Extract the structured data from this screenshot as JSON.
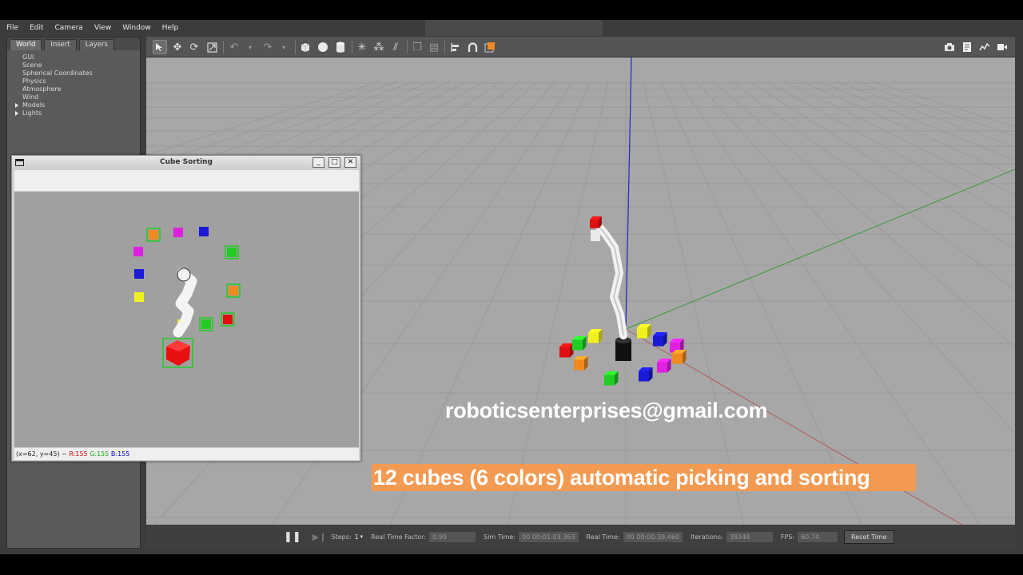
{
  "menubar": {
    "items": [
      "File",
      "Edit",
      "Camera",
      "View",
      "Window",
      "Help"
    ]
  },
  "leftpanel": {
    "tabs": [
      "World",
      "Insert",
      "Layers"
    ],
    "tree": [
      {
        "label": "GUI",
        "expandable": false
      },
      {
        "label": "Scene",
        "expandable": false
      },
      {
        "label": "Spherical Coordinates",
        "expandable": false
      },
      {
        "label": "Physics",
        "expandable": false
      },
      {
        "label": "Atmosphere",
        "expandable": false
      },
      {
        "label": "Wind",
        "expandable": false
      },
      {
        "label": "Models",
        "expandable": true
      },
      {
        "label": "Lights",
        "expandable": true
      }
    ]
  },
  "toolbar": {
    "icons": [
      "select-arrow-icon",
      "translate-icon",
      "rotate-icon",
      "scale-icon",
      "undo-icon",
      "redo-icon",
      "box-shape-icon",
      "sphere-shape-icon",
      "cylinder-shape-icon",
      "point-light-icon",
      "spot-light-icon",
      "directional-light-icon",
      "copy-icon",
      "paste-icon",
      "align-icon",
      "snap-icon",
      "view-angle-icon",
      "screenshot-icon",
      "log-icon",
      "plot-icon",
      "record-icon"
    ]
  },
  "cv_window": {
    "title": "Cube Sorting",
    "status": {
      "coords": "(x=62, y=45) ~",
      "r": "R:155",
      "g": "G:155",
      "b": "B:155"
    }
  },
  "bottombar": {
    "steps_label": "Steps:",
    "steps_value": "1",
    "rtf_label": "Real Time Factor:",
    "rtf_value": "0.99",
    "sim_label": "Sim Time:",
    "sim_value": "00 00:01:03.363",
    "real_label": "Real Time:",
    "real_value": "00 00:00:39.460",
    "iter_label": "Iterations:",
    "iter_value": "38348",
    "fps_label": "FPS:",
    "fps_value": "60.74",
    "reset_label": "Reset Time"
  },
  "overlay": {
    "email": "roboticsenterprises@gmail.com",
    "caption": "12 cubes (6 colors) automatic picking and sorting"
  },
  "colors": {
    "red": "#e01010",
    "green": "#22cc22",
    "blue": "#1a1ad6",
    "yellow": "#f0f020",
    "orange": "#f08a20",
    "magenta": "#e020e0",
    "caption_bg": "#f39a52",
    "viewport_bg": "#a7a7a7"
  }
}
